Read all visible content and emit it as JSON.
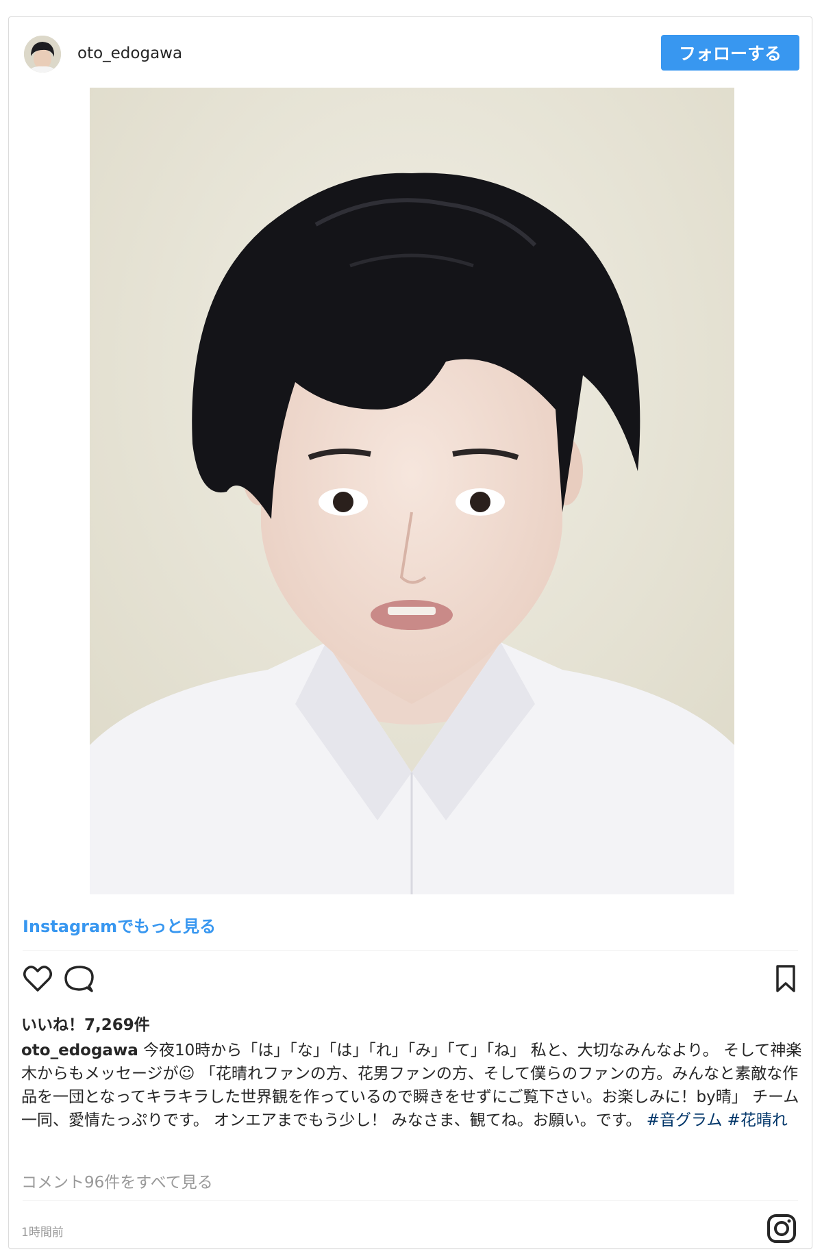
{
  "header": {
    "username": "oto_edogawa",
    "follow_label": "フォローする"
  },
  "post": {
    "more_link": "Instagramでもっと見る",
    "likes": "いいね！7,269件",
    "caption_user": "oto_edogawa",
    "caption_text": " 今夜10時から「は」「な」「は」「れ」「み」「て」「ね」 私と、大切なみんなより。 そして神楽木からもメッセージが☺ 「花晴れファンの方、花男ファンの方、そして僕らのファンの方。みんなと素敵な作品を一団となってキラキラした世界観を作っているので瞬きをせずにご覧下さい。お楽しみに！by晴」 チーム一同、愛情たっぷりです。 オンエアまでもう少し！ みなさま、観てね。お願い。です。 ",
    "hashtags": [
      "#音グラム",
      "#花晴れ"
    ],
    "comments_link": "コメント96件をすべて見る",
    "time": "1時間前"
  },
  "icons": {
    "like": "heart-icon",
    "comment": "comment-icon",
    "save": "bookmark-icon",
    "brand": "instagram-icon"
  },
  "colors": {
    "accent": "#3897f0",
    "text": "#262626",
    "muted": "#999999",
    "hashtag": "#003569"
  }
}
